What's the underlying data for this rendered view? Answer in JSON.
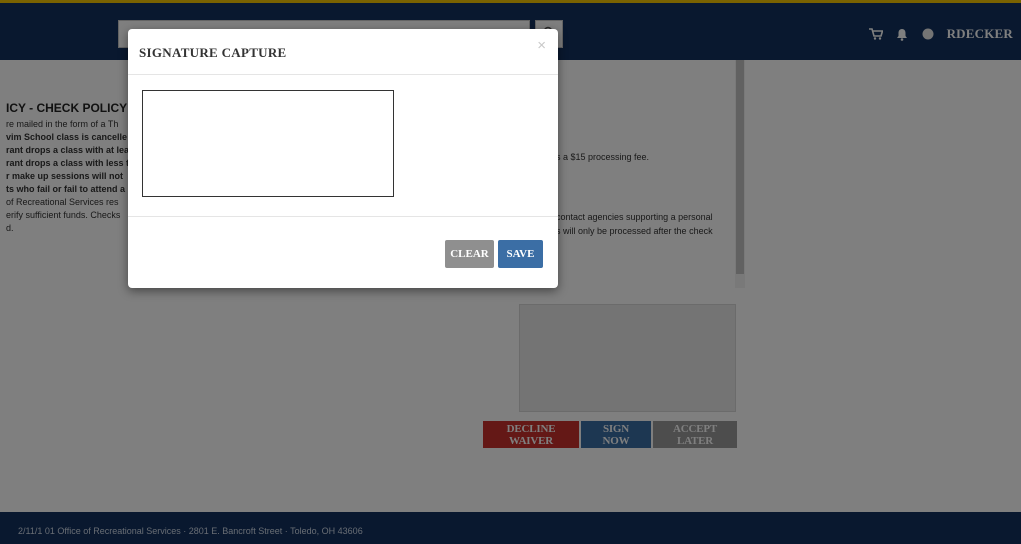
{
  "header": {
    "username": "RDECKER",
    "icons": [
      "search-icon",
      "cart-icon",
      "bell-icon",
      "user-status-icon"
    ]
  },
  "policy": {
    "title": "ICY - CHECK POLICY",
    "lines": [
      "re mailed in the form of a Th",
      "vim School class is cancelle",
      "rant drops a class with at lea",
      "rant drops a class with less t",
      "r make up sessions will not",
      "ts who fail or fail to attend a",
      " of Recreational Services res",
      "erify sufficient funds. Checks",
      "d."
    ],
    "right_text_1": "s a $15 processing fee.",
    "right_text_2": "contact agencies supporting a personal",
    "right_text_3": "s will only be processed after the check"
  },
  "actions": {
    "decline_label": "DECLINE WAIVER",
    "sign_label": "SIGN NOW",
    "later_label": "ACCEPT LATER"
  },
  "footer": {
    "text": "2/11/1 01     Office of Recreational Services · 2801 E. Bancroft Street · Toledo, OH 43606"
  },
  "modal": {
    "title": "SIGNATURE CAPTURE",
    "close_symbol": "×",
    "clear_label": "CLEAR",
    "save_label": "SAVE"
  },
  "colors": {
    "navy": "#12315f",
    "accent_yellow": "#f5c400",
    "decline_red": "#c9302c",
    "primary_blue": "#3b6ea5",
    "neutral_gray": "#8f8f8f"
  }
}
